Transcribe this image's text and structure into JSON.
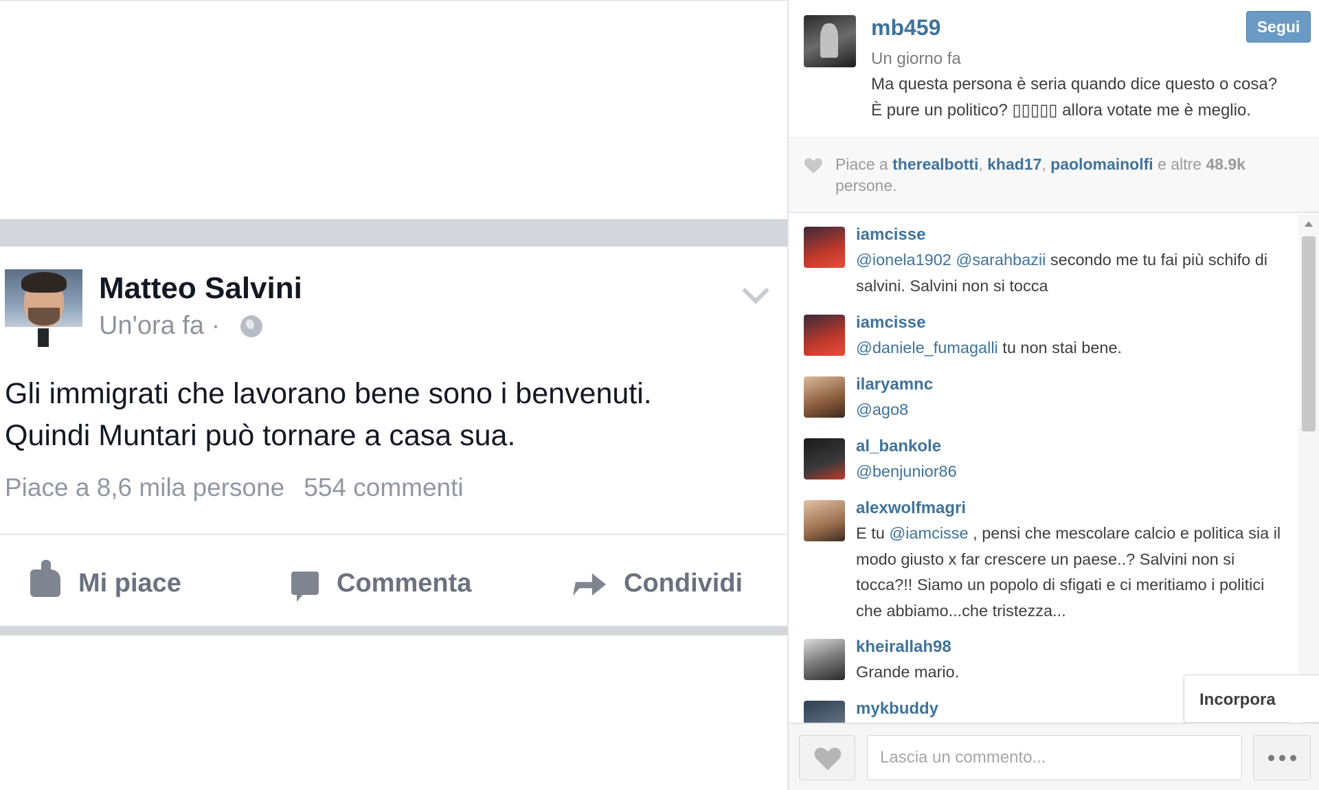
{
  "facebook_post": {
    "author": "Matteo Salvini",
    "time": "Un'ora fa",
    "separator": "·",
    "text_line1": "Gli immigrati che lavorano bene sono i benvenuti.",
    "text_line2": "Quindi Muntari può tornare a casa sua.",
    "likes": "Piace a 8,6 mila persone",
    "comments": "554 commenti",
    "actions": {
      "like": "Mi piace",
      "comment": "Commenta",
      "share": "Condividi"
    },
    "icons": {
      "globe": "globe-icon",
      "chevron": "chevron-down-icon",
      "like": "thumbs-up-icon",
      "comment": "speech-bubble-icon",
      "share": "share-arrow-icon"
    }
  },
  "instagram": {
    "username": "mb459",
    "follow_label": "Segui",
    "date": "Un giorno fa",
    "caption_line1": "Ma questa persona è seria quando dice questo o cosa?",
    "caption_line2": "È pure un politico? ▯▯▯▯▯ allora votate me è meglio.",
    "likes_prefix": "Piace a",
    "likes_users": [
      "therealbotti",
      "khad17",
      "paolomainolfi"
    ],
    "likes_middle": "e altre",
    "likes_count": "48.9k",
    "likes_suffix": "persone.",
    "comments": [
      {
        "user": "iamcisse",
        "mention1": "@ionela1902",
        "mention2": "@sarahbazii",
        "text": " secondo me tu fai più schifo di salvini. Salvini non si tocca"
      },
      {
        "user": "iamcisse",
        "mention1": "@daniele_fumagalli",
        "text": " tu non stai bene."
      },
      {
        "user": "ilaryamnc",
        "mention1": "@ago8"
      },
      {
        "user": "al_bankole",
        "mention1": "@benjunior86"
      },
      {
        "user": "alexwolfmagri",
        "prefix": "E tu ",
        "mention1": "@iamcisse",
        "text": " , pensi che mescolare calcio e politica sia il modo giusto x far crescere un paese..? Salvini non si tocca?!! Siamo un popolo di sfigati e ci meritiamo i politici che abbiamo...che tristezza..."
      },
      {
        "user": "kheirallah98",
        "text": "Grande mario."
      },
      {
        "user": "mykbuddy"
      }
    ],
    "embed_label": "Incorpora",
    "comment_placeholder": "Lascia un commento...",
    "colors": {
      "link": "#3f729b",
      "follow": "#6b9ac4"
    },
    "icons": {
      "heart": "heart-icon",
      "more": "more-dots-icon",
      "scroll_up": "scroll-up-arrow-icon"
    }
  }
}
